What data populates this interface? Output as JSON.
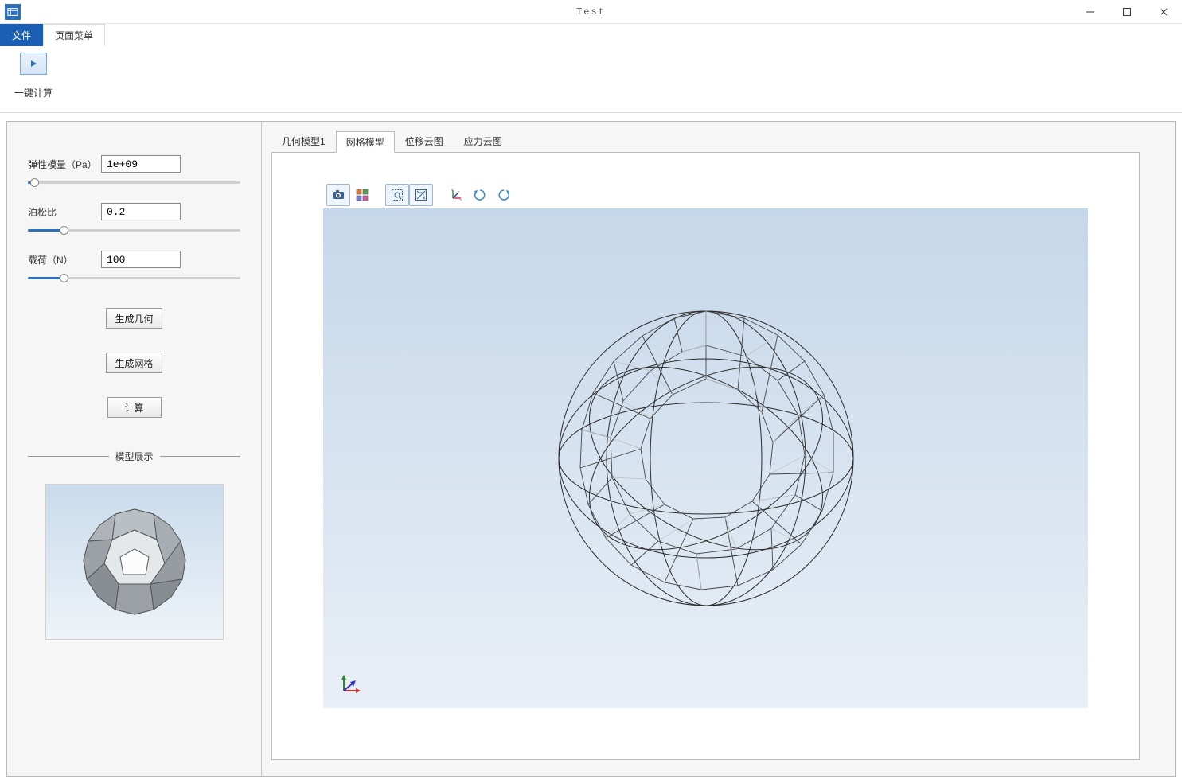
{
  "window": {
    "title": "Test"
  },
  "menu": {
    "file": "文件",
    "page_menu": "页面菜单"
  },
  "ribbon": {
    "compute_label": "一键计算"
  },
  "params": {
    "elastic_label": "弹性模量（Pa）",
    "elastic_value": "1e+09",
    "elastic_pos_pct": 3,
    "poisson_label": "泊松比",
    "poisson_value": "0.2",
    "poisson_pos_pct": 17,
    "load_label": "载荷（N）",
    "load_value": "100",
    "load_pos_pct": 17
  },
  "buttons": {
    "gen_geometry": "生成几何",
    "gen_mesh": "生成网格",
    "compute": "计算"
  },
  "preview_title": "模型展示",
  "view_tabs": {
    "geom": "几何模型1",
    "mesh": "网格模型",
    "disp": "位移云图",
    "stress": "应力云图",
    "active": "mesh"
  },
  "canvas_tools": {
    "camera": "camera-icon",
    "multiview": "multiview-icon",
    "zoom_box": "zoom-box-icon",
    "fit": "fit-view-icon",
    "axes": "axes-icon",
    "rotate_cw": "rotate-cw-icon",
    "rotate_ccw": "rotate-ccw-icon"
  }
}
